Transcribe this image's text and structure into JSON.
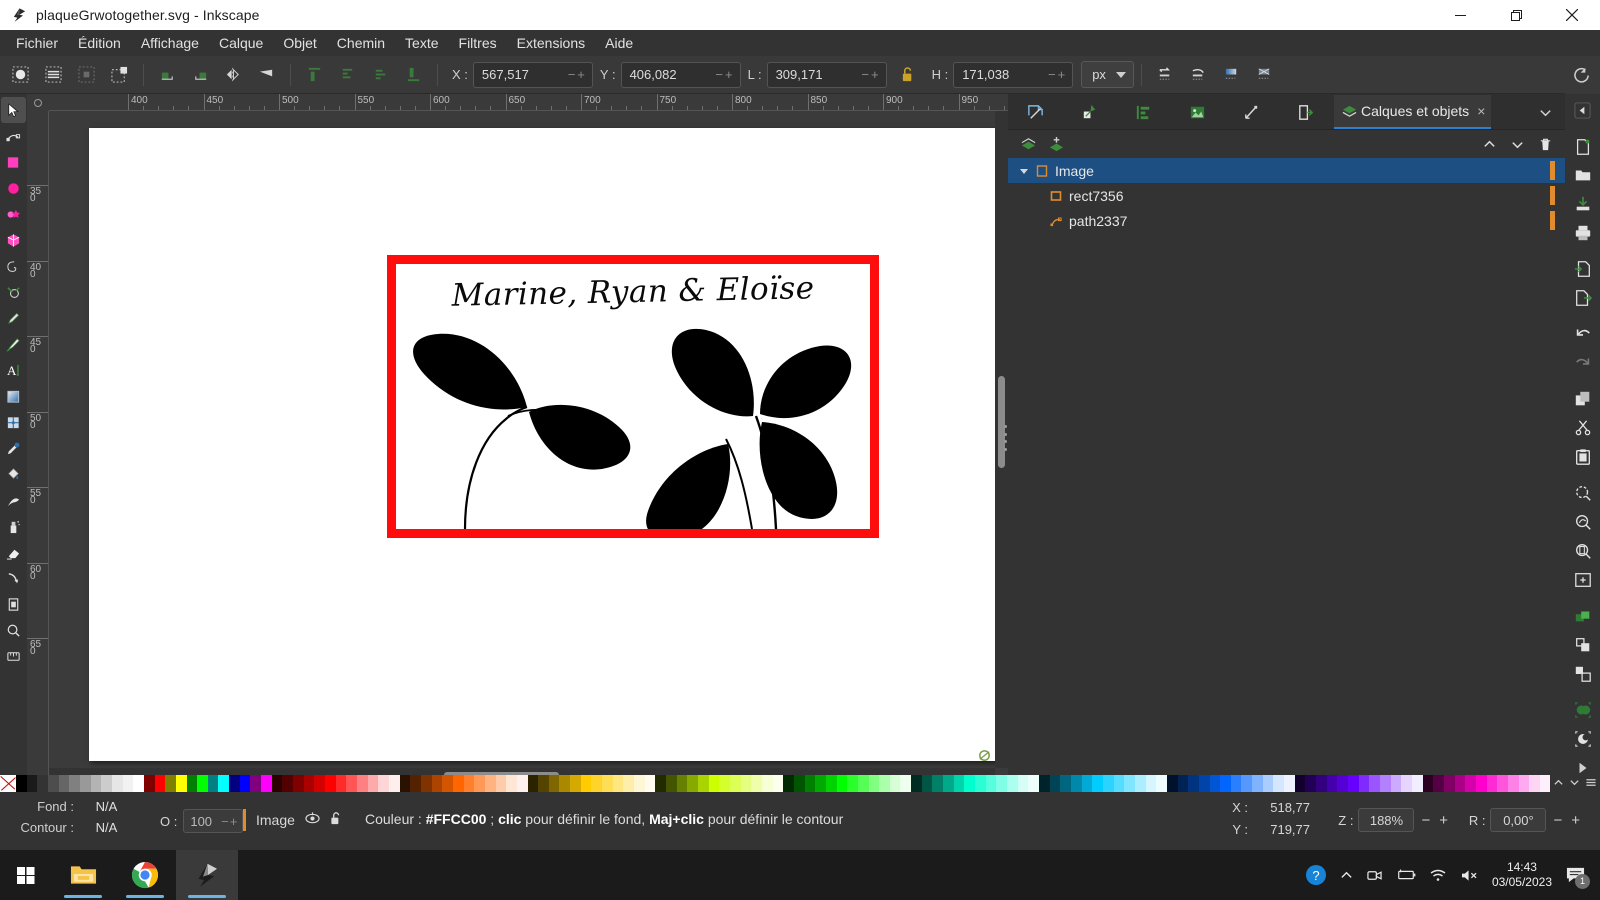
{
  "window": {
    "title": "plaqueGrwotogether.svg - Inkscape",
    "app_icon": "inkscape-logo-icon",
    "minimize": "minimize-icon",
    "maximize": "maximize-icon",
    "close": "close-icon"
  },
  "menubar": {
    "items": [
      {
        "label": "Fichier"
      },
      {
        "label": "Édition"
      },
      {
        "label": "Affichage"
      },
      {
        "label": "Calque"
      },
      {
        "label": "Objet"
      },
      {
        "label": "Chemin"
      },
      {
        "label": "Texte"
      },
      {
        "label": "Filtres"
      },
      {
        "label": "Extensions"
      },
      {
        "label": "Aide"
      }
    ]
  },
  "toolcontrols": {
    "select_all_label": "select-all-icon",
    "fields": [
      {
        "key": "x",
        "label": "X :",
        "value": "567,517"
      },
      {
        "key": "y",
        "label": "Y :",
        "value": "406,082"
      },
      {
        "key": "w",
        "label": "L :",
        "value": "309,171"
      },
      {
        "key": "h",
        "label": "H :",
        "value": "171,038"
      }
    ],
    "lock_icon": "lock-open-icon",
    "units": "px",
    "steppers": "−+"
  },
  "toolbox": {
    "tools": [
      {
        "name": "selector-tool",
        "active": true
      },
      {
        "name": "node-tool",
        "active": false
      },
      {
        "name": "rectangle-tool",
        "active": false
      },
      {
        "name": "ellipse-tool",
        "active": false
      },
      {
        "name": "star-tool",
        "active": false
      },
      {
        "name": "box3d-tool",
        "active": false
      },
      {
        "name": "spiral-tool",
        "active": false
      },
      {
        "name": "pencil-tool",
        "active": false
      },
      {
        "name": "pen-tool",
        "active": false
      },
      {
        "name": "calligraphy-tool",
        "active": false
      },
      {
        "name": "text-tool",
        "active": false
      },
      {
        "name": "gradient-tool",
        "active": false
      },
      {
        "name": "mesh-tool",
        "active": false
      },
      {
        "name": "dropper-tool",
        "active": false
      },
      {
        "name": "paintbucket-tool",
        "active": false
      },
      {
        "name": "tweak-tool",
        "active": false
      },
      {
        "name": "spray-tool",
        "active": false
      },
      {
        "name": "eraser-tool",
        "active": false
      },
      {
        "name": "connector-tool",
        "active": false
      },
      {
        "name": "page-tool",
        "active": false
      },
      {
        "name": "zoom-tool",
        "active": false
      },
      {
        "name": "measure-tool",
        "active": false
      }
    ]
  },
  "rulers": {
    "horizontal": [
      "400",
      "450",
      "500",
      "550",
      "600",
      "650",
      "700",
      "750",
      "800",
      "850",
      "900",
      "950"
    ],
    "vertical": [
      "350",
      "400",
      "450",
      "500",
      "550",
      "600",
      "650"
    ]
  },
  "artwork": {
    "title_text": "Marine, Ryan & Eloïse",
    "border_color": "#FF0D0D",
    "background_color": "#FFFFFF",
    "leaf_color": "#000000"
  },
  "dock": {
    "tabs": [
      {
        "name": "xml-editor-tab",
        "icon": "xml-editor-icon"
      },
      {
        "name": "objects-tab",
        "icon": "object-properties-icon"
      },
      {
        "name": "align-tab",
        "icon": "align-icon"
      },
      {
        "name": "export-tab",
        "icon": "export-image-icon"
      },
      {
        "name": "paths-tab",
        "icon": "path-effects-icon"
      },
      {
        "name": "document-tab",
        "icon": "document-properties-icon"
      }
    ],
    "active_tab": {
      "label": "Calques et objets",
      "icon": "layers-icon",
      "close": "×"
    },
    "more_tabs_icon": "chevron-down-icon",
    "toolrow": [
      {
        "name": "new-layer-button",
        "icon": "layer-new-icon"
      },
      {
        "name": "add-layer-button",
        "icon": "layer-add-icon"
      },
      {
        "name": "raise-layer-button",
        "icon": "chevron-up-icon"
      },
      {
        "name": "lower-layer-button",
        "icon": "chevron-down-icon"
      },
      {
        "name": "delete-layer-button",
        "icon": "trash-icon"
      }
    ],
    "layers": [
      {
        "label": "Image",
        "type": "layer",
        "selected": true,
        "indent": 0,
        "expander": "▾"
      },
      {
        "label": "rect7356",
        "type": "rect",
        "selected": false,
        "indent": 1,
        "expander": ""
      },
      {
        "label": "path2337",
        "type": "path",
        "selected": false,
        "indent": 1,
        "expander": ""
      }
    ]
  },
  "commandbar": {
    "collapse_icon": "collapse-panel-icon",
    "buttons": [
      {
        "name": "new-document-button",
        "icon": "document-new-icon"
      },
      {
        "name": "open-document-button",
        "icon": "folder-open-icon"
      },
      {
        "name": "save-document-button",
        "icon": "save-icon"
      },
      {
        "name": "print-button",
        "icon": "printer-icon"
      },
      {
        "name": "import-button",
        "icon": "import-icon"
      },
      {
        "name": "export-button",
        "icon": "export-icon"
      },
      {
        "name": "undo-button",
        "icon": "undo-icon"
      },
      {
        "name": "redo-button",
        "icon": "redo-icon"
      },
      {
        "name": "copy-button",
        "icon": "copy-icon"
      },
      {
        "name": "cut-button",
        "icon": "scissors-icon"
      },
      {
        "name": "paste-button",
        "icon": "paste-icon"
      },
      {
        "name": "zoom-selection-button",
        "icon": "zoom-selection-icon"
      },
      {
        "name": "zoom-drawing-button",
        "icon": "zoom-drawing-icon"
      },
      {
        "name": "zoom-page-button",
        "icon": "zoom-page-icon"
      },
      {
        "name": "zoom-fit-button",
        "icon": "zoom-fit-icon"
      },
      {
        "name": "duplicate-button",
        "icon": "duplicate-icon"
      },
      {
        "name": "group-button",
        "icon": "group-icon"
      },
      {
        "name": "ungroup-button",
        "icon": "ungroup-icon"
      },
      {
        "name": "union-button",
        "icon": "union-icon"
      },
      {
        "name": "difference-button",
        "icon": "difference-icon"
      },
      {
        "name": "menu-overflow-button",
        "icon": "hamburger-icon"
      }
    ]
  },
  "statusbar": {
    "fill_label": "Fond :",
    "fill_value": "N/A",
    "stroke_label": "Contour :",
    "stroke_value": "N/A",
    "opacity_label": "O :",
    "opacity_value": "100",
    "layer_name": "Image",
    "layer_visibility_icon": "eye-icon",
    "layer_lock_icon": "unlock-icon",
    "message_prefix": "Couleur : ",
    "message_color": "#FFCC00",
    "message_mid": " ; ",
    "message_click": "clic",
    "message_click_rest": " pour définir le fond, ",
    "message_shift": "Maj+clic",
    "message_shift_rest": " pour définir le contour",
    "pointer_x_label": "X :",
    "pointer_x_value": "518,77",
    "pointer_y_label": "Y :",
    "pointer_y_value": "719,77",
    "zoom_label": "Z :",
    "zoom_value": "188%",
    "rotation_label": "R :",
    "rotation_value": "0,00°",
    "minus": "−",
    "plus": "+"
  },
  "taskbar": {
    "start_icon": "windows-start-icon",
    "apps": [
      {
        "name": "file-explorer-icon",
        "active": false
      },
      {
        "name": "chrome-icon",
        "active": false
      },
      {
        "name": "inkscape-icon",
        "active": true
      }
    ],
    "tray": [
      {
        "name": "help-circle-icon"
      },
      {
        "name": "show-hidden-icons-icon"
      },
      {
        "name": "webcam-icon"
      },
      {
        "name": "battery-icon"
      },
      {
        "name": "wifi-icon"
      },
      {
        "name": "volume-muted-icon"
      }
    ],
    "time": "14:43",
    "date": "03/05/2023",
    "notification_icon": "notification-icon",
    "notification_count": "1"
  },
  "palette": {
    "no_color_swatch": "none-swatch",
    "colors": [
      "#000000",
      "#1a1a1a",
      "#333333",
      "#4d4d4d",
      "#666666",
      "#808080",
      "#999999",
      "#b3b3b3",
      "#cccccc",
      "#e6e6e6",
      "#f2f2f2",
      "#ffffff",
      "#800000",
      "#ff0000",
      "#808000",
      "#ffff00",
      "#008000",
      "#00ff00",
      "#008080",
      "#00ffff",
      "#000080",
      "#0000ff",
      "#800080",
      "#ff00ff",
      "#2b0000",
      "#550000",
      "#800000",
      "#aa0000",
      "#d40000",
      "#ff0000",
      "#ff2a2a",
      "#ff5555",
      "#ff8080",
      "#ffaaaa",
      "#ffd5d5",
      "#ffeeee",
      "#2b1100",
      "#552200",
      "#803300",
      "#aa4400",
      "#d45500",
      "#ff6600",
      "#ff7f2a",
      "#ff9955",
      "#ffb380",
      "#ffccaa",
      "#ffe6d5",
      "#fff2ee",
      "#2b2200",
      "#554400",
      "#806600",
      "#aa8800",
      "#d4aa00",
      "#ffcc00",
      "#ffd42a",
      "#ffdd55",
      "#ffe680",
      "#ffeeaa",
      "#fff6d5",
      "#fffbee",
      "#222b00",
      "#445500",
      "#668000",
      "#88aa00",
      "#aad400",
      "#ccff00",
      "#d4ff2a",
      "#ddff55",
      "#e6ff80",
      "#eeffaa",
      "#f6ffd5",
      "#fbffee",
      "#002b00",
      "#005500",
      "#008000",
      "#00aa00",
      "#00d400",
      "#00ff00",
      "#2aff2a",
      "#55ff55",
      "#80ff80",
      "#aaffaa",
      "#d5ffd5",
      "#eeffee",
      "#002b22",
      "#005544",
      "#008066",
      "#00aa88",
      "#00d4aa",
      "#00ffcc",
      "#2affd4",
      "#55ffdd",
      "#80ffe6",
      "#aaffee",
      "#d5fff6",
      "#eefffb",
      "#00222b",
      "#004455",
      "#006680",
      "#0088aa",
      "#00aad4",
      "#00ccff",
      "#2ad4ff",
      "#55ddff",
      "#80e6ff",
      "#aaeeff",
      "#d5f6ff",
      "#eefbff",
      "#00112b",
      "#002255",
      "#003380",
      "#0044aa",
      "#0055d4",
      "#0066ff",
      "#2a7fff",
      "#5599ff",
      "#80b3ff",
      "#aaccff",
      "#d5e6ff",
      "#eef2ff",
      "#11002b",
      "#220055",
      "#330080",
      "#4400aa",
      "#5500d4",
      "#6600ff",
      "#7f2aff",
      "#9955ff",
      "#b380ff",
      "#ccaaff",
      "#e6d5ff",
      "#f2eeff",
      "#2b0022",
      "#550044",
      "#800066",
      "#aa0088",
      "#d400aa",
      "#ff00cc",
      "#ff2ad4",
      "#ff55dd",
      "#ff80e6",
      "#ffaaee",
      "#ffd5f6",
      "#ffeefb"
    ],
    "scroll_up_icon": "chevron-up-icon",
    "scroll_down_icon": "chevron-down-icon",
    "menu_icon": "palette-menu-icon"
  }
}
